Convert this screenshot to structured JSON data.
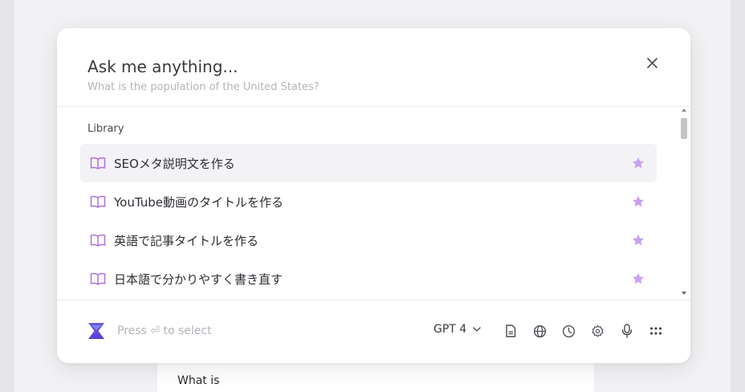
{
  "background": {
    "doc_text": "What is"
  },
  "modal": {
    "input_placeholder": "Ask me anything...",
    "hint": "What is the population of the United States?",
    "close_icon": "close-icon"
  },
  "library": {
    "title": "Library",
    "items": [
      {
        "label": "SEOメタ説明文を作る",
        "icon": "book-icon",
        "starred": true
      },
      {
        "label": "YouTube動画のタイトルを作る",
        "icon": "book-icon",
        "starred": true
      },
      {
        "label": "英語で記事タイトルを作る",
        "icon": "book-icon",
        "starred": true
      },
      {
        "label": "日本語で分かりやすく書き直す",
        "icon": "book-icon",
        "starred": true
      }
    ]
  },
  "footer": {
    "select_hint": "Press ⏎ to select",
    "model": "GPT 4",
    "tools": [
      "document-icon",
      "globe-icon",
      "clock-icon",
      "gear-icon",
      "microphone-icon",
      "grid-icon"
    ]
  },
  "colors": {
    "accent": "#b070e0",
    "star": "#c9a3ee",
    "logo_top": "#6a5be6",
    "logo_bottom": "#5b3fd6"
  }
}
